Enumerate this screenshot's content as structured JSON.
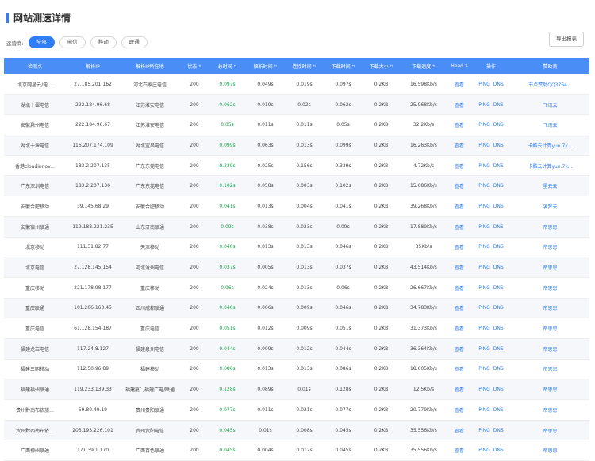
{
  "page": {
    "title": "网站测速详情"
  },
  "filters": {
    "label": "运营商:",
    "options": [
      "全部",
      "电信",
      "移动",
      "联通"
    ],
    "active_index": 0
  },
  "export_label": "导出报表",
  "table": {
    "headers": [
      "检测点",
      "解析IP",
      "解析IP所在地",
      "状态",
      "总时间",
      "解析时间",
      "连接时间",
      "下载时间",
      "下载大小",
      "下载速度",
      "Head",
      "操作",
      "赞助商"
    ],
    "sortable": [
      false,
      false,
      false,
      true,
      true,
      true,
      true,
      true,
      true,
      true,
      true,
      false,
      false
    ],
    "head_link": "查看",
    "ops": [
      "PING",
      "DNS"
    ],
    "rows": [
      {
        "node": "北京网星云/电...",
        "ip": "27.185.201.162",
        "loc": "河北石家庄电信",
        "status": "200",
        "total": "0.097s",
        "dns": "0.049s",
        "conn": "0.019s",
        "dl": "0.097s",
        "size": "0.2KB",
        "speed": "16.598Kb/s",
        "sponsor": "节点赞助QQ3764..."
      },
      {
        "node": "湖北十堰电信",
        "ip": "222.184.96.68",
        "loc": "江苏淮安电信",
        "status": "200",
        "total": "0.062s",
        "dns": "0.019s",
        "conn": "0.02s",
        "dl": "0.062s",
        "size": "0.2KB",
        "speed": "25.968Kb/s",
        "sponsor": "飞讯云"
      },
      {
        "node": "安徽滁州电信",
        "ip": "222.184.96.67",
        "loc": "江苏淮安电信",
        "status": "200",
        "total": "0.05s",
        "dns": "0.011s",
        "conn": "0.011s",
        "dl": "0.05s",
        "size": "0.2KB",
        "speed": "32.2Kb/s",
        "sponsor": "飞讯云"
      },
      {
        "node": "湖北十堰电信",
        "ip": "116.207.174.109",
        "loc": "湖北宜昌电信",
        "status": "200",
        "total": "0.099s",
        "dns": "0.063s",
        "conn": "0.013s",
        "dl": "0.099s",
        "size": "0.2KB",
        "speed": "16.263Kb/s",
        "sponsor": "卡酷云计算yun.7k..."
      },
      {
        "node": "香港cloudinnov...",
        "ip": "183.2.207.135",
        "loc": "广东东莞电信",
        "status": "200",
        "total": "0.339s",
        "dns": "0.025s",
        "conn": "0.156s",
        "dl": "0.339s",
        "size": "0.2KB",
        "speed": "4.72Kb/s",
        "sponsor": "卡酷云计算yun.7k..."
      },
      {
        "node": "广东深圳电信",
        "ip": "183.2.207.136",
        "loc": "广东东莞电信",
        "status": "200",
        "total": "0.102s",
        "dns": "0.058s",
        "conn": "0.003s",
        "dl": "0.102s",
        "size": "0.2KB",
        "speed": "15.686Kb/s",
        "sponsor": "星云云"
      },
      {
        "node": "安徽合肥移动",
        "ip": "39.145.68.29",
        "loc": "安徽合肥移动",
        "status": "200",
        "total": "0.041s",
        "dns": "0.013s",
        "conn": "0.004s",
        "dl": "0.041s",
        "size": "0.2KB",
        "speed": "39.268Kb/s",
        "sponsor": "溪梦云"
      },
      {
        "node": "安徽宿州联通",
        "ip": "119.188.221.235",
        "loc": "山东济南联通",
        "status": "200",
        "total": "0.09s",
        "dns": "0.038s",
        "conn": "0.023s",
        "dl": "0.09s",
        "size": "0.2KB",
        "speed": "17.889Kb/s",
        "sponsor": "帝思思"
      },
      {
        "node": "北京移动",
        "ip": "111.31.82.77",
        "loc": "天津移动",
        "status": "200",
        "total": "0.046s",
        "dns": "0.013s",
        "conn": "0.013s",
        "dl": "0.046s",
        "size": "0.2KB",
        "speed": "35Kb/s",
        "sponsor": "帝思思"
      },
      {
        "node": "北京电信",
        "ip": "27.128.145.154",
        "loc": "河北沧州电信",
        "status": "200",
        "total": "0.037s",
        "dns": "0.005s",
        "conn": "0.013s",
        "dl": "0.037s",
        "size": "0.2KB",
        "speed": "43.514Kb/s",
        "sponsor": "帝思思"
      },
      {
        "node": "重庆移动",
        "ip": "221.178.98.177",
        "loc": "重庆移动",
        "status": "200",
        "total": "0.06s",
        "dns": "0.024s",
        "conn": "0.013s",
        "dl": "0.06s",
        "size": "0.2KB",
        "speed": "26.667Kb/s",
        "sponsor": "帝思思"
      },
      {
        "node": "重庆联通",
        "ip": "101.206.163.45",
        "loc": "四川成都联通",
        "status": "200",
        "total": "0.046s",
        "dns": "0.006s",
        "conn": "0.009s",
        "dl": "0.046s",
        "size": "0.2KB",
        "speed": "34.783Kb/s",
        "sponsor": "帝思思"
      },
      {
        "node": "重庆电信",
        "ip": "61.128.154.187",
        "loc": "重庆电信",
        "status": "200",
        "total": "0.051s",
        "dns": "0.012s",
        "conn": "0.009s",
        "dl": "0.051s",
        "size": "0.2KB",
        "speed": "31.373Kb/s",
        "sponsor": "帝思思"
      },
      {
        "node": "福建龙岩电信",
        "ip": "117.24.8.127",
        "loc": "福建泉州电信",
        "status": "200",
        "total": "0.044s",
        "dns": "0.009s",
        "conn": "0.012s",
        "dl": "0.044s",
        "size": "0.2KB",
        "speed": "36.364Kb/s",
        "sponsor": "帝思思"
      },
      {
        "node": "福建三明移动",
        "ip": "112.50.96.89",
        "loc": "福建移动",
        "status": "200",
        "total": "0.086s",
        "dns": "0.013s",
        "conn": "0.013s",
        "dl": "0.086s",
        "size": "0.2KB",
        "speed": "18.605Kb/s",
        "sponsor": "帝思思"
      },
      {
        "node": "福建福州联通",
        "ip": "119.233.139.33",
        "loc": "福建厦门福建广电/联通",
        "status": "200",
        "total": "0.128s",
        "dns": "0.089s",
        "conn": "0.01s",
        "dl": "0.128s",
        "size": "0.2KB",
        "speed": "12.5Kb/s",
        "sponsor": "帝思思"
      },
      {
        "node": "贵州黔南布依族...",
        "ip": "59.80.49.19",
        "loc": "贵州贵阳联通",
        "status": "200",
        "total": "0.077s",
        "dns": "0.011s",
        "conn": "0.021s",
        "dl": "0.077s",
        "size": "0.2KB",
        "speed": "20.779Kb/s",
        "sponsor": "帝思思"
      },
      {
        "node": "贵州黔西南布依...",
        "ip": "203.193.226.101",
        "loc": "贵州贵阳电信",
        "status": "200",
        "total": "0.045s",
        "dns": "0.01s",
        "conn": "0.008s",
        "dl": "0.045s",
        "size": "0.2KB",
        "speed": "35.556Kb/s",
        "sponsor": "帝思思"
      },
      {
        "node": "广西柳州联通",
        "ip": "171.39.1.170",
        "loc": "广西百色联通",
        "status": "200",
        "total": "0.045s",
        "dns": "0.004s",
        "conn": "0.012s",
        "dl": "0.045s",
        "size": "0.2KB",
        "speed": "35.556Kb/s",
        "sponsor": "帝思思"
      }
    ]
  }
}
